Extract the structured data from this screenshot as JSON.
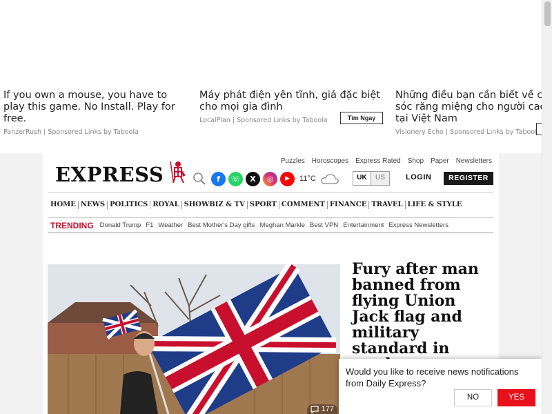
{
  "ads": [
    {
      "title": "If you own a mouse, you have to play this game. No Install. Play for free.",
      "source": "PanzerRush | Sponsored Links by Taboola"
    },
    {
      "title": "Máy phát điện yên tĩnh, giá đặc biệt cho mọi gia đình",
      "source": "LocalPlan | Sponsored Links by Taboola",
      "cta": "Tìm Ngay"
    },
    {
      "title": "Những điều bạn cần biết về chăm sóc răng miệng cho người cao tuổi tại Việt Nam",
      "source": "Visionery Echo | Sponsored Links by Taboola"
    }
  ],
  "util_nav": [
    "Puzzles",
    "Horoscopes",
    "Express Rated",
    "Shop",
    "Paper",
    "Newsletters"
  ],
  "logo": "EXPRESS",
  "social_icons": [
    "facebook-icon",
    "whatsapp-icon",
    "x-icon",
    "instagram-icon",
    "youtube-icon"
  ],
  "weather": {
    "temp": "11°C",
    "icon": "cloud-icon"
  },
  "edition": {
    "uk": "UK",
    "us": "US"
  },
  "auth": {
    "login": "LOGIN",
    "register": "REGISTER"
  },
  "main_nav": [
    "HOME",
    "NEWS",
    "POLITICS",
    "ROYAL",
    "SHOWBIZ & TV",
    "SPORT",
    "COMMENT",
    "FINANCE",
    "TRAVEL",
    "LIFE & STYLE"
  ],
  "trending": {
    "label": "TRENDING",
    "items": [
      "Donald Trump",
      "F1",
      "Weather",
      "Best Mother's Day gifts",
      "Meghan Markle",
      "Best VPN",
      "Entertainment",
      "Express Newsletters"
    ]
  },
  "hero": {
    "headline": "Fury after man banned from flying Union Jack flag and military standard in garden",
    "comments": "177"
  },
  "notification": {
    "text": "Would you like to receive news notifications from Daily Express?",
    "no": "NO",
    "yes": "YES"
  },
  "colors": {
    "brand_red": "#c8102e",
    "yes_button": "#e8101a"
  }
}
